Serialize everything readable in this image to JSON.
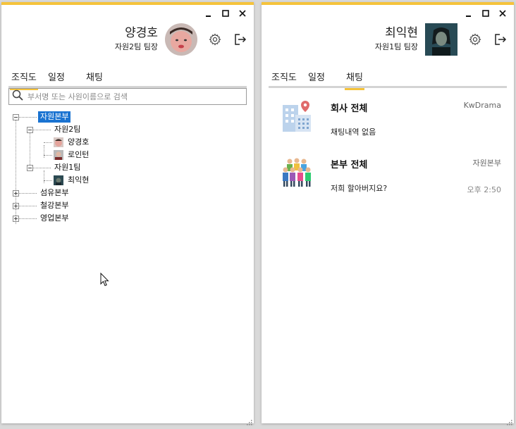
{
  "left_window": {
    "user_name": "양경호",
    "user_role": "자원2팀 팀장",
    "tabs": [
      "조직도",
      "일정",
      "채팅"
    ],
    "active_tab": "조직도",
    "search_placeholder": "부서명 또는 사원이름으로 검색",
    "tree": {
      "dept1": "자원본부",
      "team2": "자원2팀",
      "member_a": "양경호",
      "member_b": "로인턴",
      "team1": "자원1팀",
      "member_c": "최익현",
      "dept2": "섬유본부",
      "dept3": "철강본부",
      "dept4": "영업본부"
    }
  },
  "right_window": {
    "user_name": "최익현",
    "user_role": "자원1팀 팀장",
    "tabs": [
      "조직도",
      "일정",
      "채팅"
    ],
    "active_tab": "채팅",
    "chats": [
      {
        "title": "회사 전체",
        "meta": "KwDrama",
        "message": "채팅내역 없음",
        "time": ""
      },
      {
        "title": "본부 전체",
        "meta": "자원본부",
        "message": "저희 할아버지요?",
        "time": "오후 2:50"
      }
    ]
  },
  "icons": [
    "minimize-icon",
    "maximize-icon",
    "close-icon",
    "gear-icon",
    "logout-icon",
    "search-icon",
    "building-icon",
    "people-group-icon",
    "resize-grip-icon",
    "mouse-cursor-icon"
  ],
  "colors": {
    "accent": "#f5c33b",
    "selection": "#1a73d1",
    "tab_underline": "#d4d4d4"
  }
}
